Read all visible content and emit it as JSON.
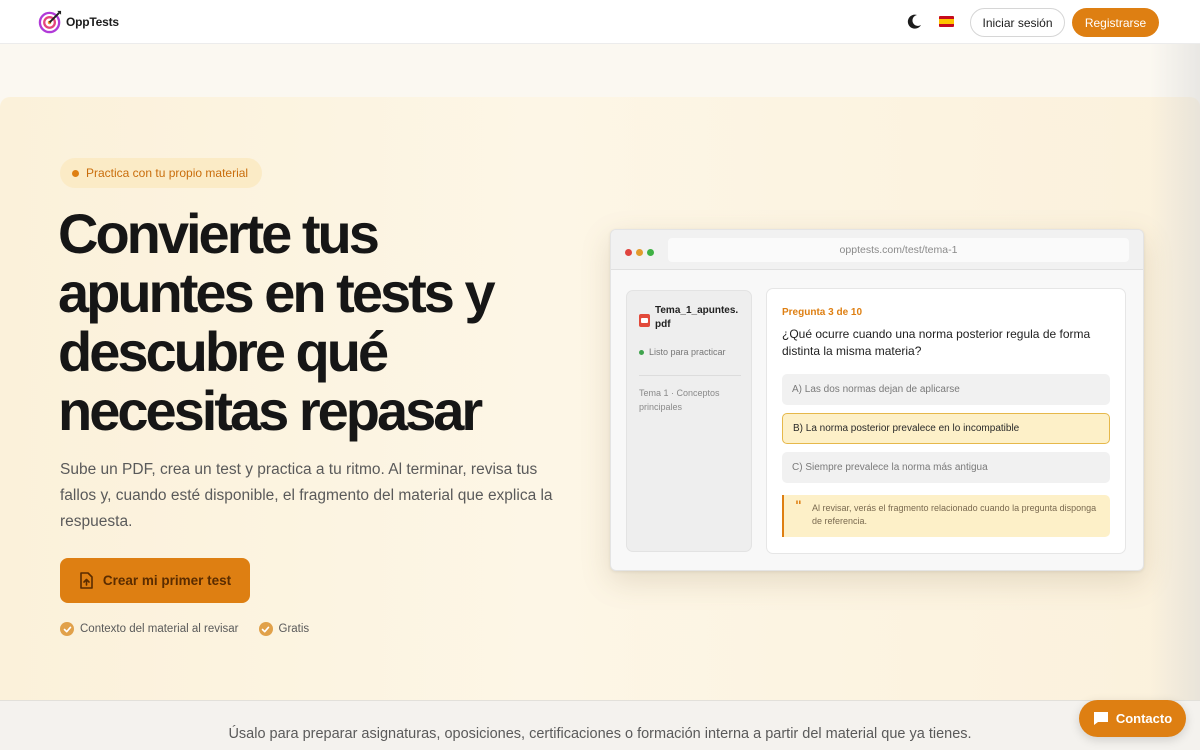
{
  "header": {
    "logo_text": "OppTests",
    "login_label": "Iniciar sesión",
    "register_label": "Registrarse",
    "theme_icon": "moon-icon",
    "language_icon": "spain-flag-icon"
  },
  "hero": {
    "tag": "Practica con tu propio material",
    "title": "Convierte tus apuntes en tests y descubre qué necesitas repasar",
    "subtitle": "Sube un PDF, crea un test y practica a tu ritmo. Al terminar, revisa tus fallos y, cuando esté disponible, el fragmento del material que explica la respuesta.",
    "cta_label": "Crear mi primer test",
    "cta_icon": "file-upload-icon",
    "checks": [
      "Contexto del material al revisar",
      "Gratis"
    ]
  },
  "mockup": {
    "url": "opptests.com/test/tema-1",
    "file_name": "Tema_1_apuntes.pdf",
    "file_status": "Listo para practicar",
    "topic": "Tema 1 · Conceptos principales",
    "question_number": "Pregunta 3 de 10",
    "question": "¿Qué ocurre cuando una norma posterior regula de forma distinta la misma materia?",
    "options": [
      "A) Las dos normas dejan de aplicarse",
      "B) La norma posterior prevalece en lo incompatible",
      "C) Siempre prevalece la norma más antigua"
    ],
    "selected_option": 1,
    "note": "Al revisar, verás el fragmento relacionado cuando la pregunta disponga de referencia."
  },
  "footer_band": {
    "text": "Úsalo para preparar asignaturas, oposiciones, certificaciones o formación interna a partir del material que ya tienes."
  },
  "contact": {
    "label": "Contacto",
    "icon": "chat-bubble-icon"
  },
  "colors": {
    "accent": "#de7f12",
    "hero_bg": "#fbf1da",
    "selected_option_bg": "#fdf0c8"
  }
}
